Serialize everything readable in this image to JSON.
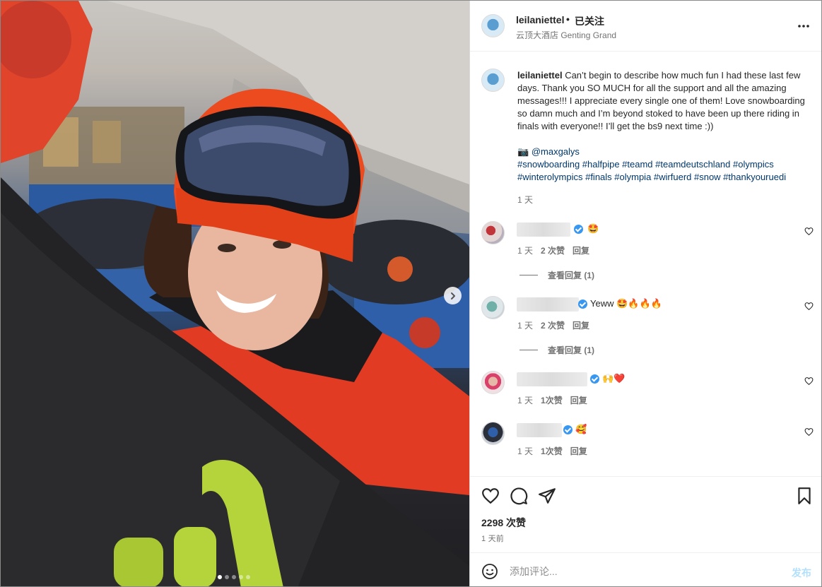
{
  "post": {
    "username": "leilaniettel",
    "separator": "•",
    "follow_label": "已关注",
    "location": "云顶大酒店 Genting Grand",
    "more_icon": "more-horizontal-icon"
  },
  "caption": {
    "username": "leilaniettel",
    "text": " Can’t begin to describe how much fun I had these last few days. Thank you SO MUCH for all the support and all the amazing messages!!! I appreciate every single one of them! Love snowboarding so damn much and I’m beyond stoked to have been up there riding in finals with everyone!! I’ll get the bs9 next time :))",
    "camera_emoji": "📷",
    "mention": "@maxgalys",
    "hashtags_line1": "#snowboarding #halfpipe #teamd #teamdeutschland #olympics",
    "hashtags_line2": "#winterolympics #finals #olympia #wirfuerd #snow #thankyouruedi",
    "time": "1 天"
  },
  "comments": [
    {
      "text": "🤩",
      "time": "1 天",
      "likes": "2 次赞",
      "reply": "回复",
      "view_replies": "查看回复 (1)"
    },
    {
      "text": "Yeww 🤩🔥🔥🔥",
      "time": "1 天",
      "likes": "2 次赞",
      "reply": "回复",
      "view_replies": "查看回复 (1)"
    },
    {
      "text": "🙌❤️",
      "time": "1 天",
      "likes": "1次赞",
      "reply": "回复"
    },
    {
      "text": "🥰",
      "time": "1 天",
      "likes": "1次赞",
      "reply": "回复"
    }
  ],
  "actions": {
    "like_icon": "heart-icon",
    "comment_icon": "comment-icon",
    "share_icon": "paper-plane-icon",
    "save_icon": "bookmark-icon",
    "likes_count": "2298 次赞",
    "post_time": "1 天前"
  },
  "add_comment": {
    "placeholder": "添加评论...",
    "post_label": "发布",
    "emoji_icon": "smiley-icon"
  },
  "carousel": {
    "total_slides": 5,
    "active_slide": 1
  },
  "colors": {
    "link": "#00376b",
    "verified": "#3897f0",
    "post_button_disabled": "#b2dffc",
    "muted_text": "#737373"
  }
}
